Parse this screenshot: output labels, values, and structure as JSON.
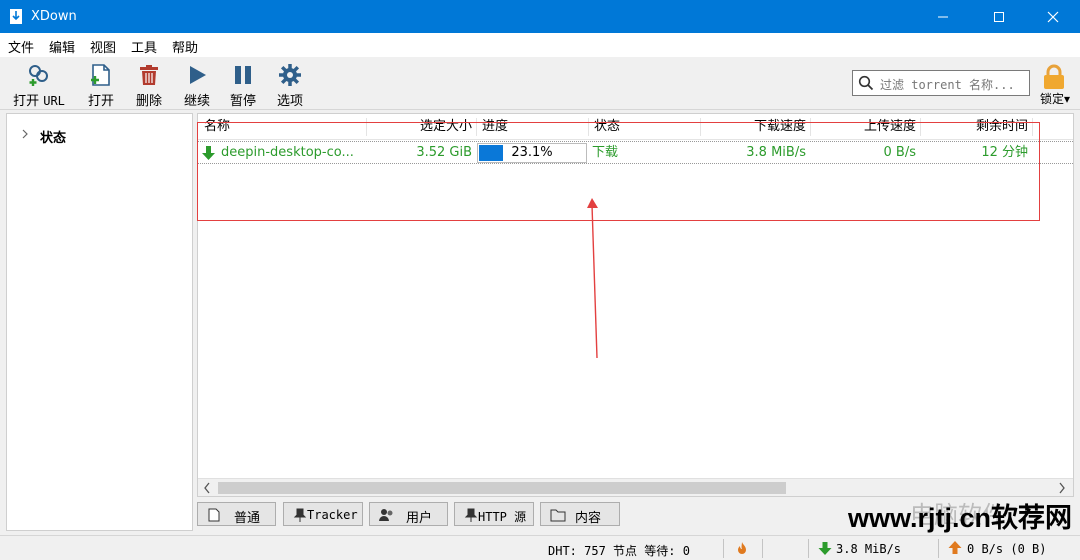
{
  "window": {
    "title": "XDown"
  },
  "menu": [
    "文件",
    "编辑",
    "视图",
    "工具",
    "帮助"
  ],
  "toolbar": {
    "open_url": {
      "cn": "打开",
      "url": "URL"
    },
    "open": "打开",
    "delete": "删除",
    "resume": "继续",
    "pause": "暂停",
    "options": "选项"
  },
  "search": {
    "placeholder": "过滤 torrent 名称..."
  },
  "lock": {
    "label": "锁定"
  },
  "sidebar": {
    "items": [
      "状态"
    ]
  },
  "table": {
    "columns": [
      "名称",
      "选定大小",
      "进度",
      "状态",
      "下载速度",
      "上传速度",
      "剩余时间"
    ],
    "rows": [
      {
        "name": "deepin-desktop-co...",
        "size": "3.52 GiB",
        "progress": "23.1%",
        "progress_fraction": 0.231,
        "status": "下载",
        "down_speed": "3.8 MiB/s",
        "up_speed": "0 B/s",
        "eta": "12 分钟"
      }
    ]
  },
  "tabs": [
    {
      "label": "普通",
      "icon": "document-icon"
    },
    {
      "label": "Tracker",
      "icon": "pin-icon"
    },
    {
      "label": "用户",
      "icon": "users-icon"
    },
    {
      "label": "HTTP 源",
      "icon": "pin-icon"
    },
    {
      "label": "内容",
      "icon": "folder-icon"
    }
  ],
  "status": {
    "dht": "DHT: 757 节点 等待: 0",
    "down": "3.8 MiB/s",
    "up": "0 B/s (0 B)"
  },
  "watermark": {
    "ghost": "电脑软件",
    "text": "www.rjtj.cn软荐网"
  },
  "colors": {
    "titlebar": "#0078d7",
    "accent_green": "#2c9b2c",
    "progress_blue": "#0a78d8",
    "annotation_red": "#e34040"
  }
}
